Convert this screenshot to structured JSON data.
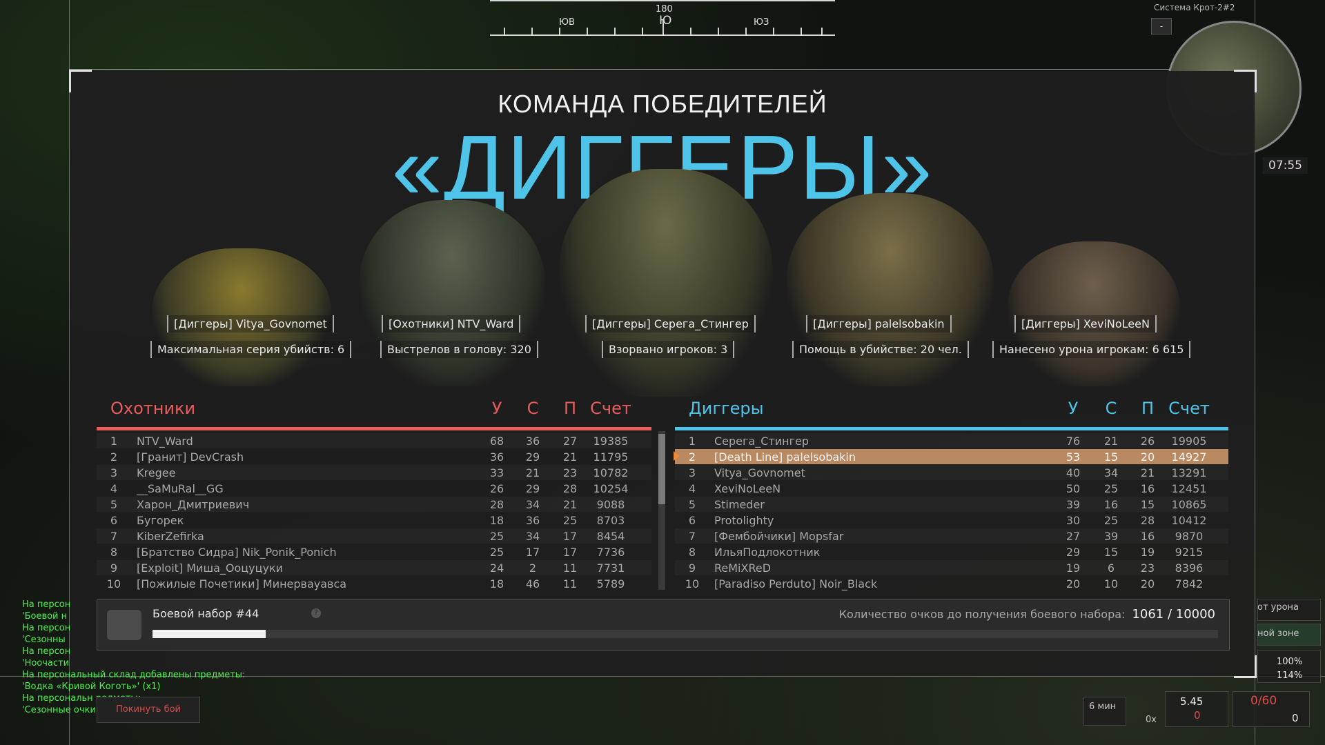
{
  "compass": {
    "degree": "180",
    "main": "Ю",
    "left": "ЮВ",
    "right": "ЮЗ"
  },
  "minimap": {
    "title": "Система Крот-2#2",
    "time": "07:55",
    "button": "-"
  },
  "winner": {
    "subtitle": "КОМАНДА ПОБЕДИТЕЛЕЙ",
    "team": "«ДИГГЕРЫ»"
  },
  "highlights": [
    {
      "name": "[Диггеры] Vitya_Govnomet",
      "stat": "Максимальная серия убийств: 6"
    },
    {
      "name": "[Охотники] NTV_Ward",
      "stat": "Выстрелов в голову: 320"
    },
    {
      "name": "[Диггеры] Серега_Стингер",
      "stat": "Взорвано игроков: 3"
    },
    {
      "name": "[Диггеры] palelsobakin",
      "stat": "Помощь в убийстве: 20 чел."
    },
    {
      "name": "[Диггеры] XeviNoLeeN",
      "stat": "Нанесено урона игрокам: 6 615"
    }
  ],
  "columns": {
    "kills": "У",
    "deaths": "С",
    "assists": "П",
    "score": "Счет"
  },
  "hunters": {
    "name": "Охотники",
    "color": "#ea5b5b",
    "rows": [
      {
        "n": "1",
        "player": "NTV_Ward",
        "k": "68",
        "d": "36",
        "a": "27",
        "s": "19385"
      },
      {
        "n": "2",
        "player": "[Гранит] DevCrash",
        "k": "36",
        "d": "29",
        "a": "21",
        "s": "11795"
      },
      {
        "n": "3",
        "player": "Kregee",
        "k": "33",
        "d": "21",
        "a": "23",
        "s": "10782"
      },
      {
        "n": "4",
        "player": "__SaMuRal__GG",
        "k": "26",
        "d": "29",
        "a": "28",
        "s": "10254"
      },
      {
        "n": "5",
        "player": "Харон_Дмитриевич",
        "k": "28",
        "d": "34",
        "a": "21",
        "s": "9088"
      },
      {
        "n": "6",
        "player": "Бугорек",
        "k": "18",
        "d": "36",
        "a": "25",
        "s": "8703"
      },
      {
        "n": "7",
        "player": "KiberZefirka",
        "k": "25",
        "d": "34",
        "a": "17",
        "s": "8454"
      },
      {
        "n": "8",
        "player": "[Братство Сидра] Nik_Ponik_Ponich",
        "k": "25",
        "d": "17",
        "a": "17",
        "s": "7736"
      },
      {
        "n": "9",
        "player": "[Exploit] Миша_Ооцуцуки",
        "k": "24",
        "d": "2",
        "a": "11",
        "s": "7731"
      },
      {
        "n": "10",
        "player": "[Пожилые Почетики] Минервауавса",
        "k": "18",
        "d": "46",
        "a": "11",
        "s": "5789"
      }
    ]
  },
  "diggers": {
    "name": "Диггеры",
    "color": "#4fc4e9",
    "rows": [
      {
        "n": "1",
        "player": "Серега_Стингер",
        "k": "76",
        "d": "21",
        "a": "26",
        "s": "19905"
      },
      {
        "n": "2",
        "player": "[Death Line] palelsobakin",
        "k": "53",
        "d": "15",
        "a": "20",
        "s": "14927"
      },
      {
        "n": "3",
        "player": "Vitya_Govnomet",
        "k": "40",
        "d": "34",
        "a": "21",
        "s": "13291"
      },
      {
        "n": "4",
        "player": "XeviNoLeeN",
        "k": "50",
        "d": "25",
        "a": "16",
        "s": "12451"
      },
      {
        "n": "5",
        "player": "Stimeder",
        "k": "39",
        "d": "16",
        "a": "15",
        "s": "10865"
      },
      {
        "n": "6",
        "player": "Protolighty",
        "k": "30",
        "d": "25",
        "a": "28",
        "s": "10412"
      },
      {
        "n": "7",
        "player": "[Фембойчики] Mopsfar",
        "k": "27",
        "d": "39",
        "a": "16",
        "s": "9870"
      },
      {
        "n": "8",
        "player": "ИльяПодлокотник",
        "k": "29",
        "d": "15",
        "a": "19",
        "s": "9215"
      },
      {
        "n": "9",
        "player": "ReMiXReD",
        "k": "19",
        "d": "6",
        "a": "23",
        "s": "8396"
      },
      {
        "n": "10",
        "player": "[Paradiso Perduto] Noir_Black",
        "k": "20",
        "d": "10",
        "a": "20",
        "s": "7842"
      }
    ],
    "highlighted_index": 1
  },
  "battle_pack": {
    "title": "Боевой набор #44",
    "info": "?",
    "points_label": "Количество очков до получения боевого набора:",
    "points": "1061 / 10000",
    "progress": 0.1061
  },
  "chat": [
    "На персон",
    "'Боевой н",
    "На персон",
    "'Сезонны",
    "На персон",
    "'Ноочасти",
    "На персональный склад добавлены предметы:",
    "'Водка «Кривой Коготь»' (x1)",
    "На персональн                    редметы:",
    "'Сезонные очки"
  ],
  "leave_button": "Покинуть бой",
  "hud": {
    "dmg_label": "от урона",
    "zone_label": "ной зоне",
    "hp1": "100%",
    "hp2": "114%",
    "timer": "6 мин",
    "ammo_mag": "0/60",
    "weight": "5.45",
    "weight_red": "0",
    "grenades": "0",
    "armor_label": "0х"
  }
}
